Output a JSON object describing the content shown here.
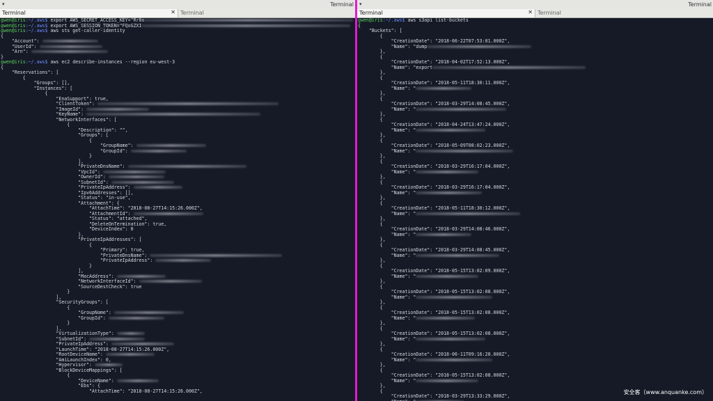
{
  "window_title": "Terminal",
  "menu_arrow": "▾",
  "close_glyph": "✕",
  "tab_label": "Terminal",
  "prompt": {
    "user_host": "gwen@iris",
    "path": ":~/.aws$"
  },
  "watermark": "安全客（www.anquanke.com）",
  "left_lines": [
    {
      "type": "prompt",
      "cmd": " export AWS_SECRET_ACCESS_KEY=\"Rr8o"
    },
    {
      "type": "prompt",
      "cmd": " export AWS_SESSION_TOKEN=\"FQoGZXI"
    },
    {
      "type": "prompt",
      "cmd": " aws sts get-caller-identity"
    },
    {
      "type": "text",
      "text": "{"
    },
    {
      "type": "text",
      "text": "    \"Account\": "
    },
    {
      "type": "text",
      "text": "    \"UserId\": "
    },
    {
      "type": "text",
      "text": "    \"Arn\": "
    },
    {
      "type": "text",
      "text": "}"
    },
    {
      "type": "prompt",
      "cmd": " aws ec2 describe-instances --region eu-west-3"
    },
    {
      "type": "text",
      "text": "{"
    },
    {
      "type": "text",
      "text": "    \"Reservations\": ["
    },
    {
      "type": "text",
      "text": "        {"
    },
    {
      "type": "text",
      "text": "            \"Groups\": [],"
    },
    {
      "type": "text",
      "text": "            \"Instances\": ["
    },
    {
      "type": "text",
      "text": "                {"
    },
    {
      "type": "text",
      "text": "                    \"EnaSupport\": true,"
    },
    {
      "type": "text",
      "text": "                    \"ClientToken\": "
    },
    {
      "type": "text",
      "text": "                    \"ImageId\": "
    },
    {
      "type": "text",
      "text": "                    \"KeyName\": "
    },
    {
      "type": "text",
      "text": "                    \"NetworkInterfaces\": ["
    },
    {
      "type": "text",
      "text": "                        {"
    },
    {
      "type": "text",
      "text": "                            \"Description\": \"\","
    },
    {
      "type": "text",
      "text": "                            \"Groups\": ["
    },
    {
      "type": "text",
      "text": "                                {"
    },
    {
      "type": "text",
      "text": "                                    \"GroupName\": "
    },
    {
      "type": "text",
      "text": "                                    \"GroupId\": "
    },
    {
      "type": "text",
      "text": "                                }"
    },
    {
      "type": "text",
      "text": "                            ],"
    },
    {
      "type": "text",
      "text": "                            \"PrivateDnsName\": "
    },
    {
      "type": "text",
      "text": "                            \"VpcId\": "
    },
    {
      "type": "text",
      "text": "                            \"OwnerId\": "
    },
    {
      "type": "text",
      "text": "                            \"SubnetId\": "
    },
    {
      "type": "text",
      "text": "                            \"PrivateIpAddress\": "
    },
    {
      "type": "text",
      "text": "                            \"Ipv6Addresses\": [],"
    },
    {
      "type": "text",
      "text": "                            \"Status\": \"in-use\","
    },
    {
      "type": "text",
      "text": "                            \"Attachment\": {"
    },
    {
      "type": "text",
      "text": "                                \"AttachTime\": \"2018-08-27T14:15:26.000Z\","
    },
    {
      "type": "text",
      "text": "                                \"AttachmentId\": "
    },
    {
      "type": "text",
      "text": "                                \"Status\": \"attached\","
    },
    {
      "type": "text",
      "text": "                                \"DeleteOnTermination\": true,"
    },
    {
      "type": "text",
      "text": "                                \"DeviceIndex\": 0"
    },
    {
      "type": "text",
      "text": "                            },"
    },
    {
      "type": "text",
      "text": "                            \"PrivateIpAddresses\": ["
    },
    {
      "type": "text",
      "text": "                                {"
    },
    {
      "type": "text",
      "text": "                                    \"Primary\": true,"
    },
    {
      "type": "text",
      "text": "                                    \"PrivateDnsName\": "
    },
    {
      "type": "text",
      "text": "                                    \"PrivateIpAddress\": "
    },
    {
      "type": "text",
      "text": "                                }"
    },
    {
      "type": "text",
      "text": "                            ],"
    },
    {
      "type": "text",
      "text": "                            \"MacAddress\": "
    },
    {
      "type": "text",
      "text": "                            \"NetworkInterfaceId\": "
    },
    {
      "type": "text",
      "text": "                            \"SourceDestCheck\": true"
    },
    {
      "type": "text",
      "text": "                        }"
    },
    {
      "type": "text",
      "text": "                    ],"
    },
    {
      "type": "text",
      "text": "                    \"SecurityGroups\": ["
    },
    {
      "type": "text",
      "text": "                        {"
    },
    {
      "type": "text",
      "text": "                            \"GroupName\": "
    },
    {
      "type": "text",
      "text": "                            \"GroupId\": "
    },
    {
      "type": "text",
      "text": "                        }"
    },
    {
      "type": "text",
      "text": "                    ],"
    },
    {
      "type": "text",
      "text": "                    \"VirtualizationType\": "
    },
    {
      "type": "text",
      "text": "                    \"SubnetId\": "
    },
    {
      "type": "text",
      "text": "                    \"PrivateIpAddress\": "
    },
    {
      "type": "text",
      "text": "                    \"LaunchTime\": \"2018-08-27T14:15:26.000Z\","
    },
    {
      "type": "text",
      "text": "                    \"RootDeviceName\": "
    },
    {
      "type": "text",
      "text": "                    \"AmiLaunchIndex\": 0,"
    },
    {
      "type": "text",
      "text": "                    \"Hypervisor\": "
    },
    {
      "type": "text",
      "text": "                    \"BlockDeviceMappings\": ["
    },
    {
      "type": "text",
      "text": "                        {"
    },
    {
      "type": "text",
      "text": "                            \"DeviceName\": "
    },
    {
      "type": "text",
      "text": "                            \"Ebs\": {"
    },
    {
      "type": "text",
      "text": "                                \"AttachTime\": \"2018-08-27T14:15:26.000Z\","
    }
  ],
  "right_command": " aws s3api list-buckets",
  "right_header": [
    "{",
    "    \"Buckets\": ["
  ],
  "buckets": [
    {
      "date": "2018-06-22T07:53:01.000Z",
      "name_prefix": "dump"
    },
    {
      "date": "2018-04-02T17:52:13.000Z",
      "name_prefix": "export"
    },
    {
      "date": "2018-05-11T18:30:11.000Z",
      "name_prefix": ""
    },
    {
      "date": "2018-03-29T14:08:45.000Z",
      "name_prefix": ""
    },
    {
      "date": "2018-04-24T13:47:24.000Z",
      "name_prefix": ""
    },
    {
      "date": "2018-05-09T08:02:23.000Z",
      "name_prefix": ""
    },
    {
      "date": "2018-03-29T16:17:04.000Z",
      "name_prefix": ""
    },
    {
      "date": "2018-03-29T16:17:04.000Z",
      "name_prefix": ""
    },
    {
      "date": "2018-05-11T18:30:12.000Z",
      "name_prefix": ""
    },
    {
      "date": "2018-03-29T14:08:46.000Z",
      "name_prefix": ""
    },
    {
      "date": "2018-03-29T14:08:45.000Z",
      "name_prefix": ""
    },
    {
      "date": "2018-05-15T13:02:09.000Z",
      "name_prefix": ""
    },
    {
      "date": "2018-05-15T13:02:08.000Z",
      "name_prefix": ""
    },
    {
      "date": "2018-05-15T13:02:08.000Z",
      "name_prefix": ""
    },
    {
      "date": "2018-05-15T13:02:08.000Z",
      "name_prefix": ""
    },
    {
      "date": "2018-06-11T09:16:28.000Z",
      "name_prefix": ""
    },
    {
      "date": "2018-05-15T13:02:08.000Z",
      "name_prefix": ""
    },
    {
      "date": "2018-03-29T13:33:29.000Z",
      "name_prefix": ""
    }
  ]
}
